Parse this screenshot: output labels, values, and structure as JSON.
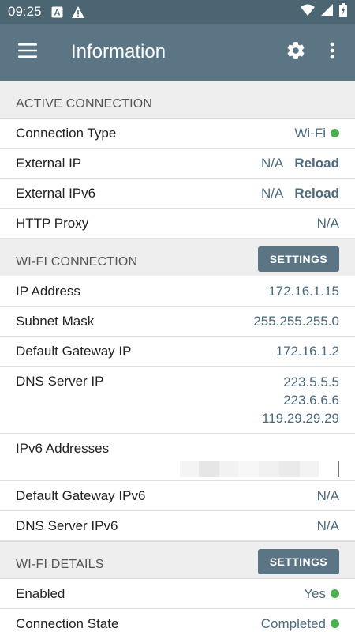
{
  "status_bar": {
    "time": "09:25"
  },
  "app_bar": {
    "title": "Information"
  },
  "active_connection": {
    "header": "ACTIVE CONNECTION",
    "rows": [
      {
        "key": "Connection Type",
        "value": "Wi-Fi"
      },
      {
        "key": "External IP",
        "value": "N/A",
        "action": "Reload"
      },
      {
        "key": "External IPv6",
        "value": "N/A",
        "action": "Reload"
      },
      {
        "key": "HTTP Proxy",
        "value": "N/A"
      }
    ]
  },
  "wifi_connection": {
    "header": "WI-FI CONNECTION",
    "button": "SETTINGS",
    "rows": [
      {
        "key": "IP Address",
        "value": "172.16.1.15"
      },
      {
        "key": "Subnet Mask",
        "value": "255.255.255.0"
      },
      {
        "key": "Default Gateway IP",
        "value": "172.16.1.2"
      },
      {
        "key": "DNS Server IP",
        "values": [
          "223.5.5.5",
          "223.6.6.6",
          "119.29.29.29"
        ]
      },
      {
        "key": "IPv6 Addresses"
      },
      {
        "key": "Default Gateway IPv6",
        "value": "N/A"
      },
      {
        "key": "DNS Server IPv6",
        "value": "N/A"
      }
    ]
  },
  "wifi_details": {
    "header": "WI-FI DETAILS",
    "button": "SETTINGS",
    "rows": [
      {
        "key": "Enabled",
        "value": "Yes"
      },
      {
        "key": "Connection State",
        "value": "Completed"
      }
    ]
  },
  "colors": {
    "app_bar": "#5b7584",
    "status_bar": "#4c6573",
    "value_text": "#4c6a7c",
    "status_dot": "#4caf50"
  }
}
